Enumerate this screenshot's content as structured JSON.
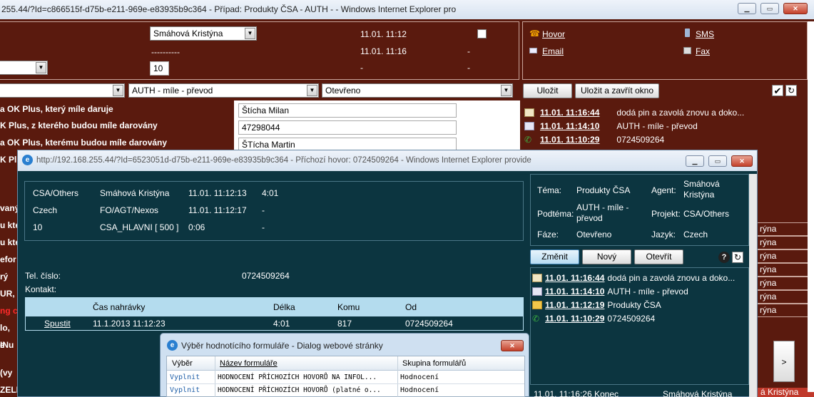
{
  "main_window": {
    "title": "255.44/?Id=c866515f-d75b-e211-969e-e83935b9c364 - Případ: Produkty ČSA - AUTH -  - Windows Internet Explorer pro"
  },
  "top_form": {
    "agent_select": "Smáhová Kristýna",
    "dashes": "----------",
    "number_input": "10",
    "times": [
      "11.01. 11:12",
      "11.01. 11:16",
      "-"
    ],
    "dashes_col": [
      "-",
      "-",
      "-"
    ],
    "links": {
      "call": "Hovor",
      "sms": "SMS",
      "email": "Email",
      "fax": "Fax"
    },
    "select_topic": "AUTH - míle - převod",
    "select_state": "Otevřeno",
    "save": "Uložit",
    "save_close": "Uložit a zavřít okno"
  },
  "fields": [
    {
      "label": "a OK Plus, který míle daruje",
      "value": "Štícha Milan"
    },
    {
      "label": "K Plus, z kterého budou míle darovány",
      "value": "47298044"
    },
    {
      "label": "a OK Plus, kterému budou míle darovány",
      "value": "ŠTícha Martin"
    }
  ],
  "left_fragments": [
    "K Pl",
    "vaný",
    "u kter",
    "u kte",
    "efor",
    "rý",
    "UR, k",
    "ng c",
    "lo,",
    "e",
    "INu",
    "(vy",
    "ZELE"
  ],
  "history_main": [
    {
      "date": "11.01. 11:16:44",
      "text": "dodá pin a zavolá znovu a doko...",
      "icon": "note-icon"
    },
    {
      "date": "11.01. 11:14:10",
      "text": "AUTH - míle - převod",
      "icon": "email-icon"
    },
    {
      "date": "11.01. 11:10:29",
      "text": "0724509264",
      "icon": "phone-icon"
    }
  ],
  "right_fragments": [
    "rýna",
    "rýna",
    "rýna",
    "rýna",
    "rýna",
    "rýna",
    "rýna"
  ],
  "call_window": {
    "title": "http://192.168.255.44/?Id=6523051d-d75b-e211-969e-e83935b9c364 - Příchozí hovor: 0724509264 - Windows Internet Explorer provide",
    "info_rows": [
      [
        "CSA/Others",
        "Smáhová Kristýna",
        "11.01. 11:12:13",
        "4:01"
      ],
      [
        "Czech",
        "FO/AGT/Nexos",
        "11.01. 11:12:17",
        "-"
      ],
      [
        "10",
        "CSA_HLAVNI [ 500 ]",
        "0:06",
        "-"
      ]
    ],
    "case": {
      "topic_label": "Téma:",
      "topic": "Produkty ČSA",
      "agent_label": "Agent:",
      "agent": "Smáhová Kristýna",
      "subtopic_label": "Podtéma:",
      "subtopic": "AUTH - míle - převod",
      "project_label": "Projekt:",
      "project": "CSA/Others",
      "phase_label": "Fáze:",
      "phase": "Otevřeno",
      "lang_label": "Jazyk:",
      "lang": "Czech"
    },
    "buttons": {
      "change": "Změnit",
      "new": "Nový",
      "open": "Otevřít"
    },
    "phone_label": "Tel. číslo:",
    "phone_value": "0724509264",
    "contact_label": "Kontakt:",
    "rec_headers": [
      "Čas nahrávky",
      "Délka",
      "Komu",
      "Od"
    ],
    "rec_row": {
      "action": "Spustit",
      "time": "11.1.2013 11:12:23",
      "length": "4:01",
      "to": "817",
      "from": "0724509264"
    },
    "history": [
      {
        "date": "11.01. 11:16:44",
        "text": "dodá pin a zavolá znovu a doko...",
        "icon": "note-icon"
      },
      {
        "date": "11.01. 11:14:10",
        "text": "AUTH - míle - převod",
        "icon": "email-icon"
      },
      {
        "date": "11.01. 11:12:19",
        "text": "Produkty ČSA",
        "icon": "folder-icon"
      },
      {
        "date": "11.01. 11:10:29",
        "text": "0724509264",
        "icon": "phone-icon"
      }
    ],
    "bottom_row": {
      "date": "11.01. 11:16:26 Konec",
      "agent": "Smáhová Kristýna"
    }
  },
  "dialog": {
    "title": "Výběr hodnotícího formuláře - Dialog webové stránky",
    "headers": [
      "Výběr",
      "Název formuláře",
      "Skupina formulářů"
    ],
    "rows": [
      {
        "action": "Vyplnit",
        "name": "HODNOCENÍ PŘÍCHOZÍCH HOVORŮ NA INFOL...",
        "group": "Hodnocení"
      },
      {
        "action": "Vyplnit",
        "name": "HODNOCENÍ PŘÍCHOZÍCH HOVORŮ (platné o...",
        "group": "Hodnocení"
      }
    ]
  },
  "side_scroll": ">",
  "bottom_right_badge": "á Kristýna"
}
